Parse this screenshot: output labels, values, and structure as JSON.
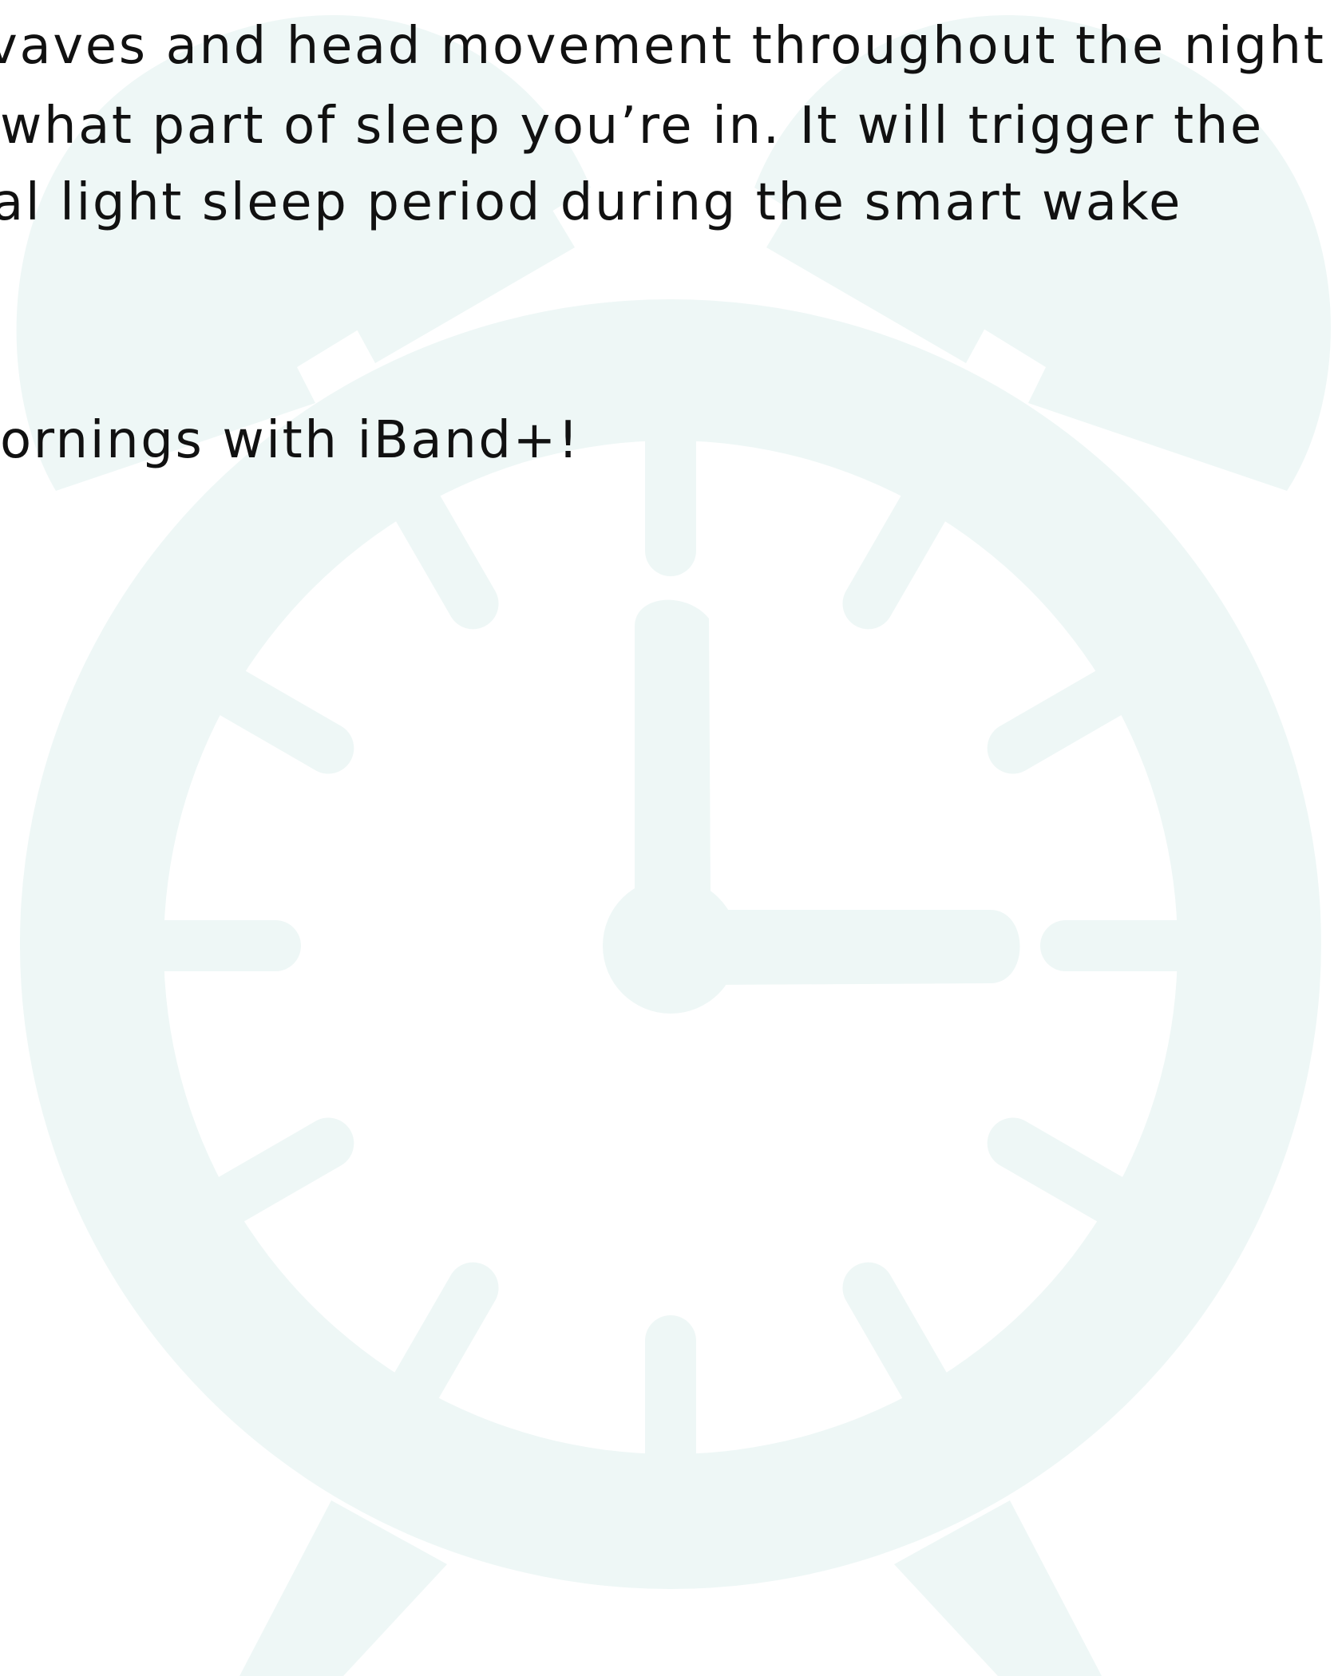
{
  "body_text": {
    "line_1": "vaves and head movement throughout the night",
    "line_2": " what part of sleep you’re in. It will trigger the",
    "line_3": "al light sleep period during the smart wake",
    "line_4": "ornings with iBand+!"
  },
  "illustration": {
    "icon": "alarm-clock-icon",
    "color": "#eef7f6"
  },
  "colors": {
    "background": "#ffffff",
    "text": "#111111"
  }
}
